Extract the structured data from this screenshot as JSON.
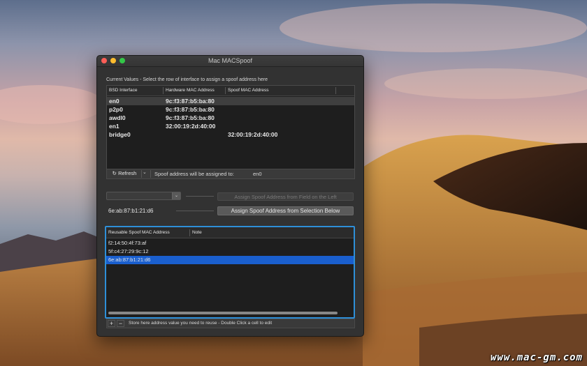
{
  "window": {
    "title": "Mac MACSpoof"
  },
  "interfaces": {
    "caption": "Current Values - Select the row of interface to assign a spoof address here",
    "headers": [
      "BSD Interface",
      "Hardware MAC Address",
      "Spoof MAC Address"
    ],
    "rows": [
      {
        "iface": "en0",
        "hw": "9c:f3:87:b5:ba:80",
        "spoof": ""
      },
      {
        "iface": "p2p0",
        "hw": "9c:f3:87:b5:ba:80",
        "spoof": ""
      },
      {
        "iface": "awdl0",
        "hw": "9c:f3:87:b5:ba:80",
        "spoof": ""
      },
      {
        "iface": "en1",
        "hw": "32:00:19:2d:40:00",
        "spoof": ""
      },
      {
        "iface": "bridge0",
        "hw": "",
        "spoof": "32:00:19:2d:40:00"
      }
    ],
    "refresh_label": "Refresh",
    "assign_status": "Spoof address will be assigned to:",
    "assign_target": "en0"
  },
  "assign": {
    "combo_value": "",
    "from_field_label": "Assign Spoof Address from Field on the Left",
    "selected_value": "6e:ab:87:b1:21:d6",
    "from_selection_label": "Assign Spoof Address from Selection Below"
  },
  "reusable": {
    "headers": [
      "Reusable Spoof MAC Address",
      "Note"
    ],
    "rows": [
      {
        "mac": "f2:14:50:4f:73:af",
        "note": ""
      },
      {
        "mac": "5f:c4:27:29:9c:12",
        "note": ""
      },
      {
        "mac": "6e:ab:87:b1:21:d6",
        "note": ""
      }
    ],
    "add_label": "+",
    "remove_label": "−",
    "hint": "Store here address value you need to reuse - Double Click a cell to edit"
  },
  "watermark": "www.mac-gm.com",
  "colors": {
    "selection_blue": "#1a5fce",
    "focus_ring": "#2e8fd8",
    "close": "#fc5e57",
    "minimize": "#fdbc2e",
    "maximize": "#33c748"
  }
}
